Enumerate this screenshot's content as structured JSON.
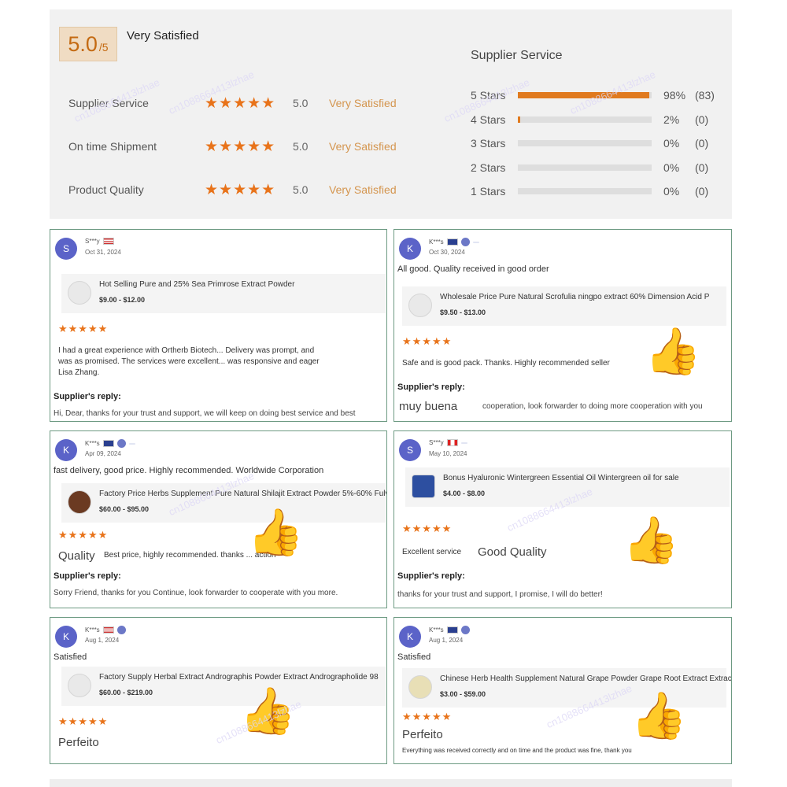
{
  "summary": {
    "score": "5.0",
    "score_den": "/5",
    "overall": "Very Satisfied",
    "ratings": [
      {
        "name": "Supplier Service",
        "stars": "★★★★★",
        "value": "5.0",
        "desc": "Very Satisfied"
      },
      {
        "name": "On time Shipment",
        "stars": "★★★★★",
        "value": "5.0",
        "desc": "Very Satisfied"
      },
      {
        "name": "Product Quality",
        "stars": "★★★★★",
        "value": "5.0",
        "desc": "Very Satisfied"
      }
    ],
    "distribution_title": "Supplier Service",
    "distribution": [
      {
        "label": "5 Stars",
        "pct": "98%",
        "count": "(83)",
        "fraction": 0.98
      },
      {
        "label": "4 Stars",
        "pct": "2%",
        "count": "(0)",
        "fraction": 0.02
      },
      {
        "label": "3 Stars",
        "pct": "0%",
        "count": "(0)",
        "fraction": 0
      },
      {
        "label": "2 Stars",
        "pct": "0%",
        "count": "(0)",
        "fraction": 0
      },
      {
        "label": "1 Stars",
        "pct": "0%",
        "count": "(0)",
        "fraction": 0
      }
    ]
  },
  "watermark": "cn1088664413lzhae",
  "thumbs_icon": "thumbs-up-icon",
  "reviews": [
    {
      "initial": "S",
      "name": "S***y",
      "date": "Oct 31, 2024",
      "comment": "",
      "product": "Hot Selling Pure and 25% Sea Primrose Extract Powder",
      "price": "$9.00 - $12.00",
      "stars": "★★★★★",
      "text": "I had a great experience with Ortherb Biotech... Delivery was prompt, and",
      "text2": "was as promised. The services were excellent... was responsive and eager",
      "text3": "Lisa Zhang.",
      "big": "",
      "reply_h": "Supplier's reply:",
      "reply": "Hi, Dear, thanks for your trust and support, we will keep on doing best service and best"
    },
    {
      "initial": "K",
      "name": "K***s",
      "date": "Oct 30, 2024",
      "comment": "All good. Quality received in good order",
      "product": "Wholesale Price Pure Natural Scrofulia ningpo extract 60% Dimension Acid P",
      "price": "$9.50 - $13.00",
      "stars": "★★★★★",
      "text": "Safe and is good pack. Thanks. Highly recommended seller",
      "big": "",
      "reply_h": "Supplier's reply:",
      "reply_big": "muy buena",
      "reply": "cooperation, look forwarder to doing more cooperation with you"
    },
    {
      "initial": "K",
      "name": "K***s",
      "date": "Apr 09, 2024",
      "comment": "fast delivery, good price. Highly recommended. Worldwide Corporation",
      "product": "Factory Price Herbs Supplement Pure Natural Shilajit Extract Powder 5%-60% Fulv",
      "price": "$60.00 - $95.00",
      "stars": "★★★★★",
      "big": "Quality",
      "text": "Best price, highly recommended. thanks ... action",
      "reply_h": "Supplier's reply:",
      "reply": "Sorry Friend, thanks for you Continue, look forwarder to cooperate with you more."
    },
    {
      "initial": "S",
      "name": "S***y",
      "date": "May 10, 2024",
      "comment": "",
      "product": "Bonus Hyaluronic Wintergreen Essential Oil Wintergreen oil for sale",
      "price": "$4.00 - $8.00",
      "stars": "★★★★★",
      "text": "Excellent service",
      "big": "Good Quality",
      "reply_h": "Supplier's reply:",
      "reply": "thanks for your trust and support, I promise, I will do better!"
    },
    {
      "initial": "K",
      "name": "K***s",
      "date": "Aug 1, 2024",
      "comment": "Satisfied",
      "product": "Factory Supply Herbal Extract Andrographis Powder Extract Andrographolide 98",
      "price": "$60.00 - $219.00",
      "stars": "★★★★★",
      "big": "Perfeito",
      "text": ""
    },
    {
      "initial": "K",
      "name": "K***s",
      "date": "Aug 1, 2024",
      "comment": "Satisfied",
      "product": "Chinese Herb Health Supplement Natural Grape Powder Grape Root Extract Extract",
      "price": "$3.00 - $59.00",
      "stars": "★★★★★",
      "big": "Perfeito",
      "text": "Everything was received correctly and on time and the product was fine, thank you"
    }
  ]
}
